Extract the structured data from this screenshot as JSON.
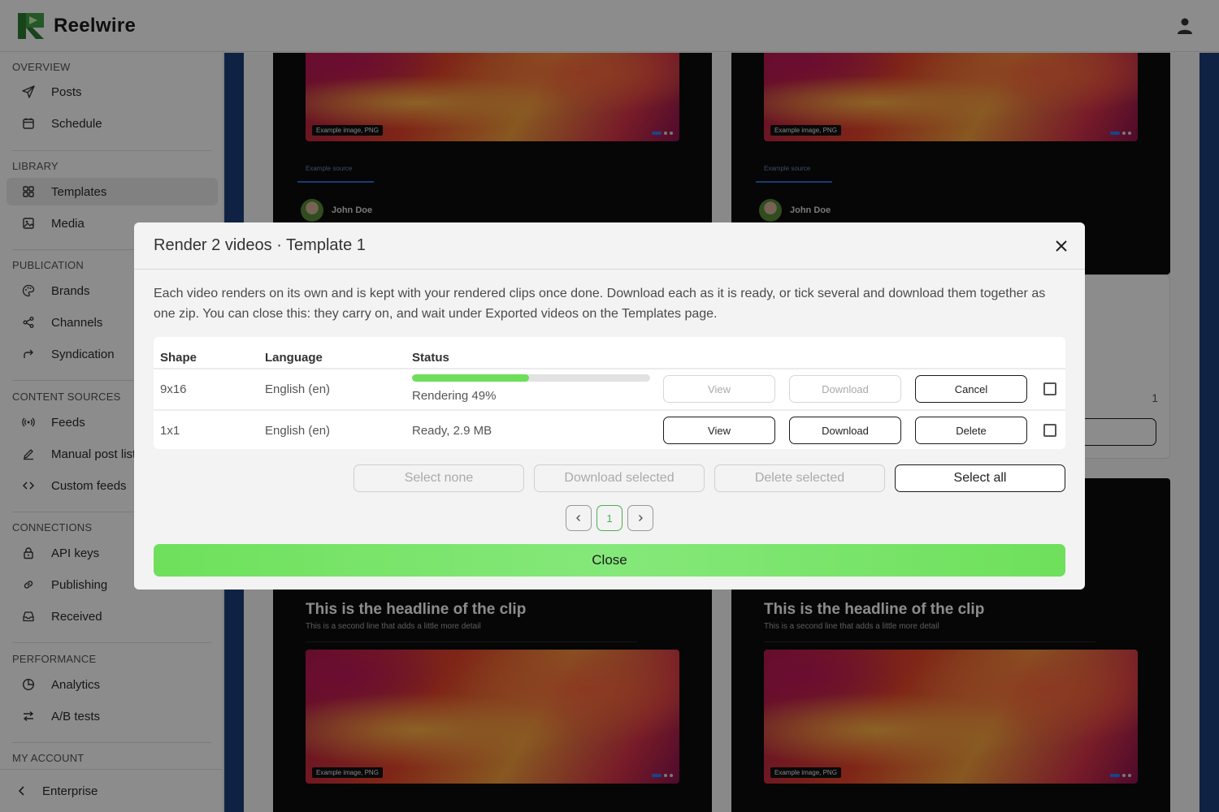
{
  "app": {
    "name": "Reelwire"
  },
  "sidebar": {
    "sections": [
      {
        "title": "OVERVIEW",
        "items": [
          {
            "label": "Posts",
            "icon": "send-icon"
          },
          {
            "label": "Schedule",
            "icon": "calendar-icon"
          }
        ]
      },
      {
        "title": "LIBRARY",
        "items": [
          {
            "label": "Templates",
            "icon": "grid-icon",
            "active": true
          },
          {
            "label": "Media",
            "icon": "image-icon"
          }
        ]
      },
      {
        "title": "PUBLICATION",
        "items": [
          {
            "label": "Brands",
            "icon": "palette-icon"
          },
          {
            "label": "Channels",
            "icon": "share-icon"
          },
          {
            "label": "Syndication",
            "icon": "forward-icon"
          }
        ]
      },
      {
        "title": "CONTENT SOURCES",
        "items": [
          {
            "label": "Feeds",
            "icon": "broadcast-icon"
          },
          {
            "label": "Manual post list",
            "icon": "pencil-icon"
          },
          {
            "label": "Custom feeds",
            "icon": "code-icon"
          }
        ]
      },
      {
        "title": "CONNECTIONS",
        "items": [
          {
            "label": "API keys",
            "icon": "lock-icon"
          },
          {
            "label": "Publishing",
            "icon": "link-icon"
          },
          {
            "label": "Received",
            "icon": "inbox-icon"
          }
        ]
      },
      {
        "title": "PERFORMANCE",
        "items": [
          {
            "label": "Analytics",
            "icon": "pie-chart-icon"
          },
          {
            "label": "A/B tests",
            "icon": "swap-icon"
          }
        ]
      },
      {
        "title": "MY ACCOUNT",
        "items": []
      }
    ],
    "footer": {
      "label": "Enterprise"
    }
  },
  "background": {
    "thumb_badge": "Example image, PNG",
    "source_label": "Example source",
    "author_name": "John Doe",
    "headline": "This is the headline of the clip",
    "subline": "This is a second line that adds a little more detail",
    "side_count": "1"
  },
  "modal": {
    "title": "Render 2 videos · Template 1",
    "description": "Each video renders on its own and is kept with your rendered clips once done. Download each as it is ready, or tick several and download them together as one zip. You can close this: they carry on, and wait under Exported videos on the Templates page.",
    "columns": {
      "shape": "Shape",
      "language": "Language",
      "status": "Status"
    },
    "rows": [
      {
        "shape": "9x16",
        "language": "English (en)",
        "status": "Rendering 49%",
        "progress": 0.49,
        "view": "View",
        "download": "Download",
        "action": "Cancel",
        "ready": false
      },
      {
        "shape": "1x1",
        "language": "English (en)",
        "status": "Ready, 2.9 MB",
        "view": "View",
        "download": "Download",
        "action": "Delete",
        "ready": true
      }
    ],
    "bulk": {
      "select_none": "Select none",
      "download_selected": "Download selected",
      "delete_selected": "Delete selected",
      "select_all": "Select all"
    },
    "pagination": {
      "current": "1"
    },
    "close_label": "Close",
    "colors": {
      "accent": "#6dde5a",
      "progress_track": "#e2e2e2",
      "current_page": "#4caf50"
    }
  }
}
